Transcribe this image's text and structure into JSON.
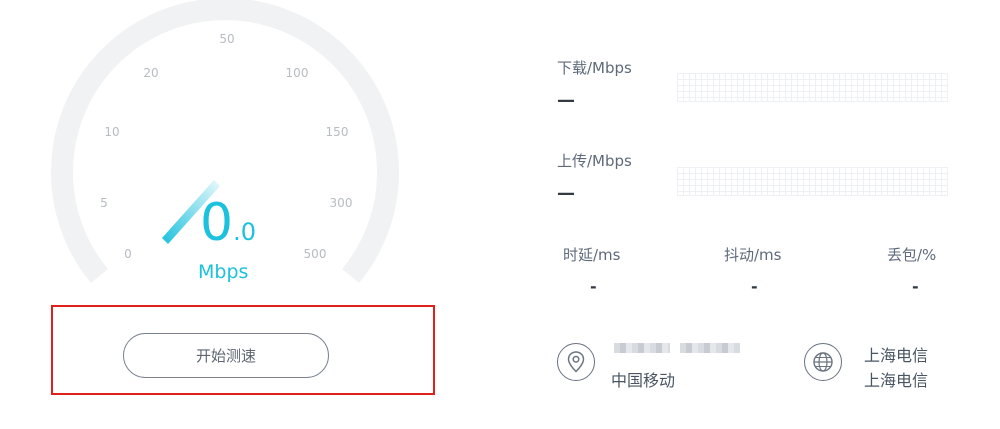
{
  "gauge": {
    "ticks": [
      "0",
      "5",
      "10",
      "20",
      "50",
      "100",
      "150",
      "300",
      "500"
    ],
    "speed_integer": "0",
    "speed_decimal": ".0",
    "unit": "Mbps",
    "accent_color": "#1cc1dd"
  },
  "start_button": {
    "label": "开始测速"
  },
  "download": {
    "label": "下载/Mbps",
    "value": "—"
  },
  "upload": {
    "label": "上传/Mbps",
    "value": "—"
  },
  "stats": [
    {
      "label": "时延/ms",
      "value": "-"
    },
    {
      "label": "抖动/ms",
      "value": "-"
    },
    {
      "label": "丢包/%",
      "value": "-"
    }
  ],
  "client": {
    "icon": "location-pin-icon",
    "isp": "中国移动"
  },
  "server": {
    "icon": "globe-icon",
    "name": "上海电信",
    "isp": "上海电信"
  }
}
